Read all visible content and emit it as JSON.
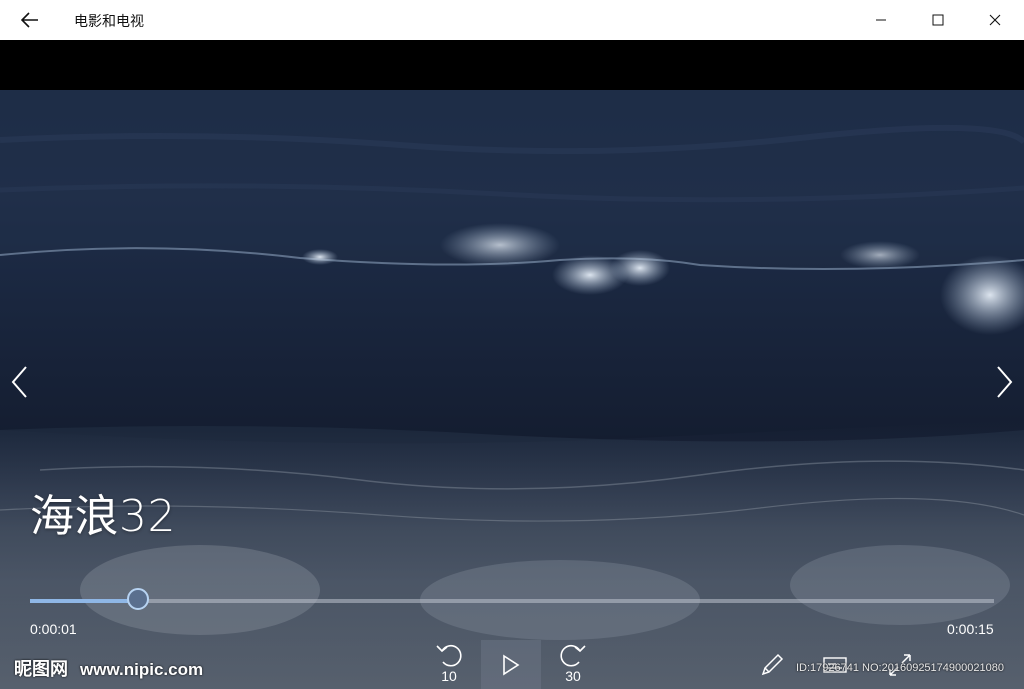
{
  "window": {
    "app_title": "电影和电视",
    "icons": {
      "back": "back-arrow-icon",
      "minimize": "minimize-icon",
      "maximize": "maximize-icon",
      "close": "close-icon"
    }
  },
  "player": {
    "title": "海浪32",
    "elapsed": "0:00:01",
    "total": "0:00:15",
    "progress_fraction": 0.112,
    "skip_back_seconds": "10",
    "skip_forward_seconds": "30",
    "accent_color": "#8fb7e6"
  },
  "watermark": {
    "logo": "昵图网",
    "url": "www.nipic.com",
    "id_text": "ID:17926741 NO:20160925174900021080"
  }
}
